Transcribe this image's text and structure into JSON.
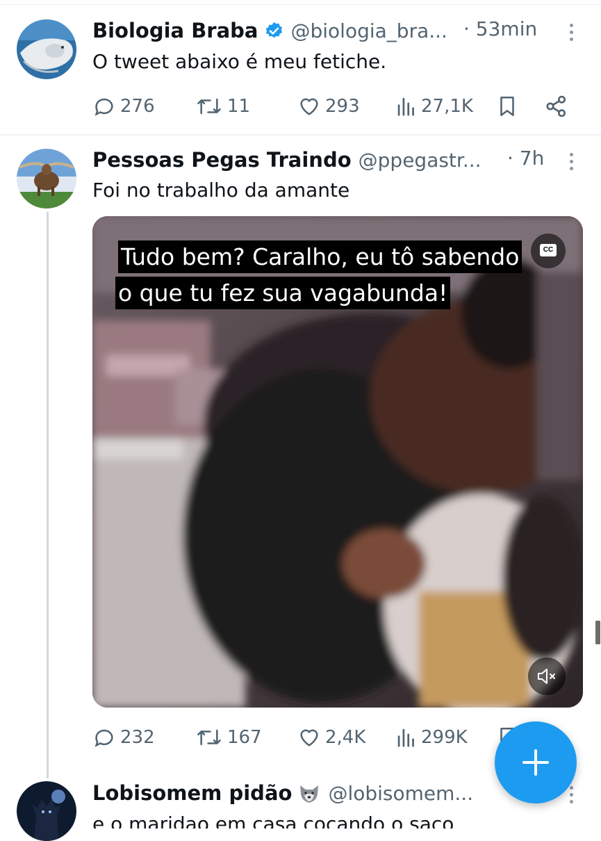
{
  "tweets": [
    {
      "name": "Biologia Braba",
      "handle": "@biologia_bra...",
      "time": "· 53min",
      "text": "O tweet abaixo é meu fetiche.",
      "verified": true,
      "stats": {
        "replies": "276",
        "retweets": "11",
        "likes": "293",
        "views": "27,1K"
      }
    },
    {
      "name": "Pessoas Pegas Traindo",
      "handle": "@ppegastr...",
      "time": "· 7h",
      "text": "Foi no trabalho da amante",
      "media": {
        "subtitle_line1": "Tudo bem? Caralho, eu tô sabendo",
        "subtitle_line2": "o que tu fez sua vagabunda!",
        "cc_label": "CC"
      },
      "stats": {
        "replies": "232",
        "retweets": "167",
        "likes": "2,4K",
        "views": "299K"
      }
    },
    {
      "name": "Lobisomem pidão",
      "handle": "@lobisomem...",
      "text": "e o maridao em casa cocando o saco"
    }
  ],
  "colors": {
    "accent": "#1d9bf0",
    "muted": "#536471",
    "text": "#0f1419"
  }
}
